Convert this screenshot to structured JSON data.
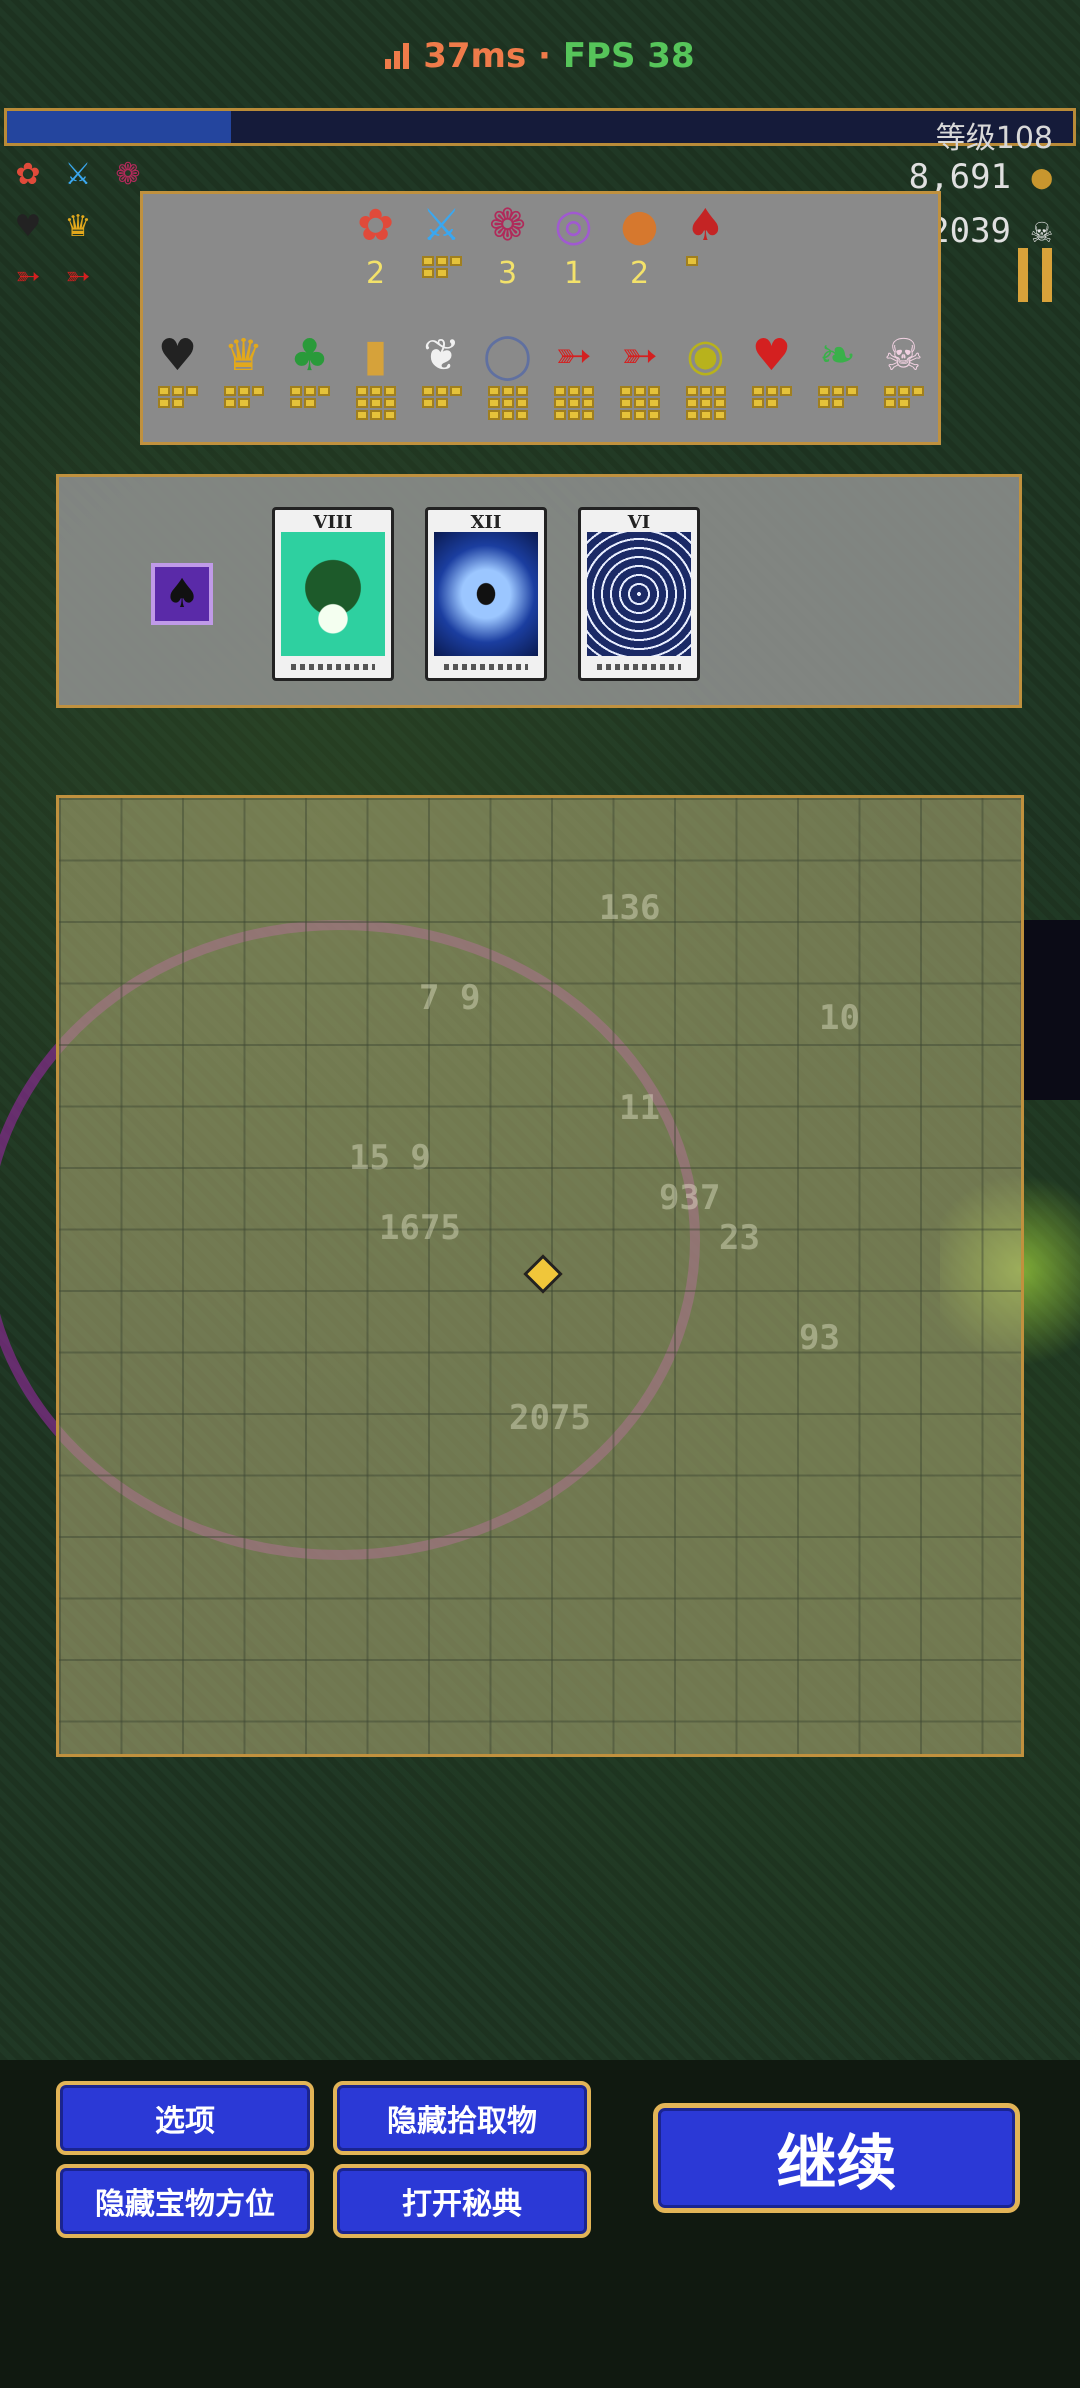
{
  "hud": {
    "ping": "37ms",
    "separator": "·",
    "fps": "FPS 38",
    "level_label": "等级108",
    "xp_fraction": 0.21,
    "gold": "8,691",
    "kills": "2039"
  },
  "inventory": {
    "weapons": [
      {
        "icon": "flower-bouquet-icon",
        "glyph": "✿",
        "color": "#e04a3a",
        "count": "2"
      },
      {
        "icon": "blue-wand-icon",
        "glyph": "⚔",
        "color": "#3aa7f0",
        "pips": 5
      },
      {
        "icon": "red-rose-icon",
        "glyph": "❁",
        "color": "#b02a5a",
        "count": "3"
      },
      {
        "icon": "purple-spiral-icon",
        "glyph": "◎",
        "color": "#a05ad0",
        "count": "1"
      },
      {
        "icon": "orange-orb-icon",
        "glyph": "●",
        "color": "#d6782e",
        "count": "2"
      },
      {
        "icon": "red-cloak-icon",
        "glyph": "♠",
        "color": "#c42424",
        "pips": 1
      }
    ],
    "passives": [
      {
        "icon": "black-heart-icon",
        "glyph": "♥",
        "color": "#222222",
        "pips": 5
      },
      {
        "icon": "crown-icon",
        "glyph": "♛",
        "color": "#e2a81c",
        "pips": 5
      },
      {
        "icon": "clover-icon",
        "glyph": "♣",
        "color": "#2a9a3a",
        "pips": 5
      },
      {
        "icon": "candle-icon",
        "glyph": "▮",
        "color": "#d6a23a",
        "pips": 9
      },
      {
        "icon": "wings-icon",
        "glyph": "❦",
        "color": "#f0f0f0",
        "pips": 5
      },
      {
        "icon": "ring-icon",
        "glyph": "◯",
        "color": "#6070a0",
        "pips": 9
      },
      {
        "icon": "red-arrow-left-icon",
        "glyph": "➳",
        "color": "#d42020",
        "pips": 9
      },
      {
        "icon": "red-arrow-right-icon",
        "glyph": "➳",
        "color": "#d42020",
        "pips": 9
      },
      {
        "icon": "gold-ring-icon",
        "glyph": "◉",
        "color": "#b8b21c",
        "pips": 9
      },
      {
        "icon": "red-heart-icon",
        "glyph": "♥",
        "color": "#d42020",
        "pips": 5
      },
      {
        "icon": "green-feather-icon",
        "glyph": "❧",
        "color": "#3ab04a",
        "pips": 5
      },
      {
        "icon": "skull-icon",
        "glyph": "☠",
        "color": "#f0d0e0",
        "pips": 5
      }
    ]
  },
  "arcana": {
    "cards": [
      {
        "numeral": "VIII",
        "art": "tree"
      },
      {
        "numeral": "XII",
        "art": "hourglass"
      },
      {
        "numeral": "VI",
        "art": "vortex"
      }
    ]
  },
  "buttons": {
    "options": "选项",
    "hide_pickups": "隐藏拾取物",
    "hide_treasure": "隐藏宝物方位",
    "open_codex": "打开秘典",
    "continue": "继续"
  }
}
